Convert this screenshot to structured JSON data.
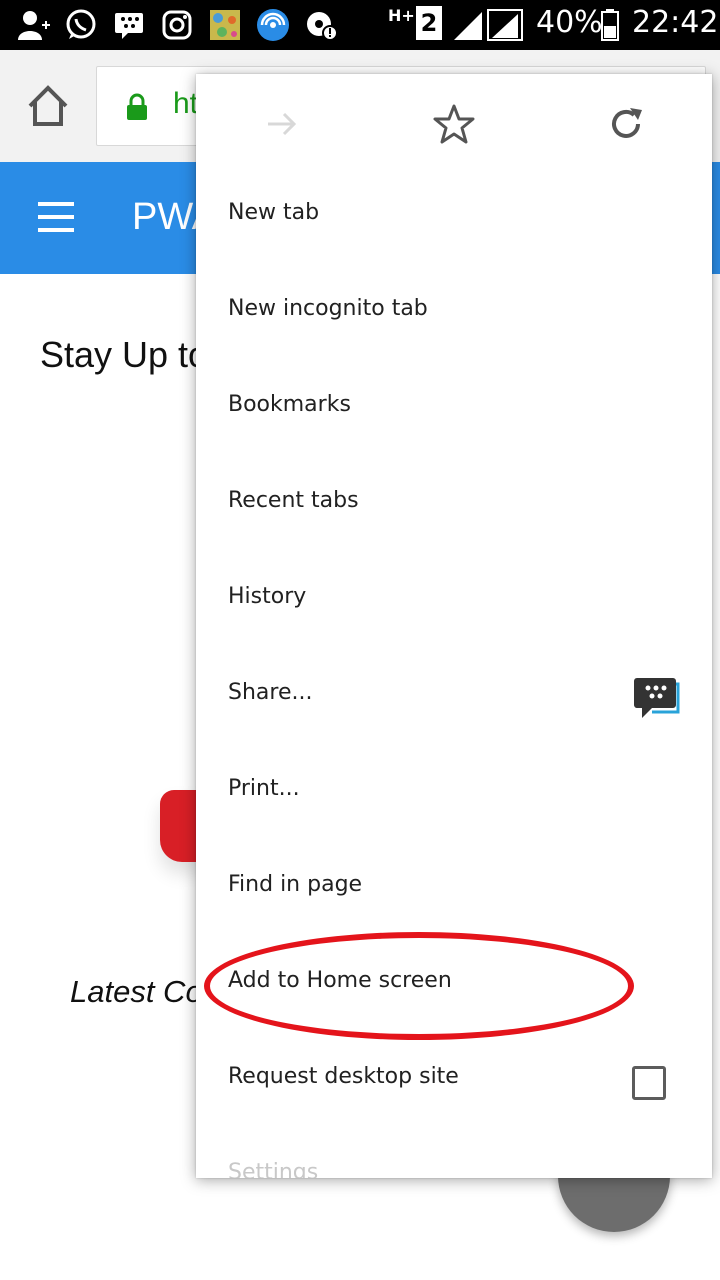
{
  "status_bar": {
    "network_type": "H+",
    "sim_slot": "2",
    "battery": "40%",
    "time": "22:42",
    "icons": [
      "add-contact-icon",
      "whatsapp-icon",
      "bbm-icon",
      "instagram-icon",
      "gallery-thumbnail-icon",
      "wifi-hotspot-icon",
      "settings-badge-icon",
      "signal-bars-icon",
      "battery-icon"
    ]
  },
  "toolbar": {
    "url_visible": "ht"
  },
  "app_header": {
    "title_visible": "PWA"
  },
  "content": {
    "headline_visible": "Stay Up to",
    "latest_visible": "Latest Co"
  },
  "menu": {
    "top_icons": [
      "forward-icon",
      "bookmark-star-icon",
      "reload-icon"
    ],
    "items": [
      {
        "label": "New tab"
      },
      {
        "label": "New incognito tab"
      },
      {
        "label": "Bookmarks"
      },
      {
        "label": "Recent tabs"
      },
      {
        "label": "History"
      },
      {
        "label": "Share..."
      },
      {
        "label": "Print..."
      },
      {
        "label": "Find in page"
      },
      {
        "label": "Add to Home screen"
      },
      {
        "label": "Request desktop site"
      },
      {
        "label": "Settings"
      }
    ],
    "request_desktop_checked": false
  },
  "colors": {
    "header_blue": "#2a8ce6",
    "highlight_red": "#e4141b",
    "url_green": "#1a9a1a"
  }
}
